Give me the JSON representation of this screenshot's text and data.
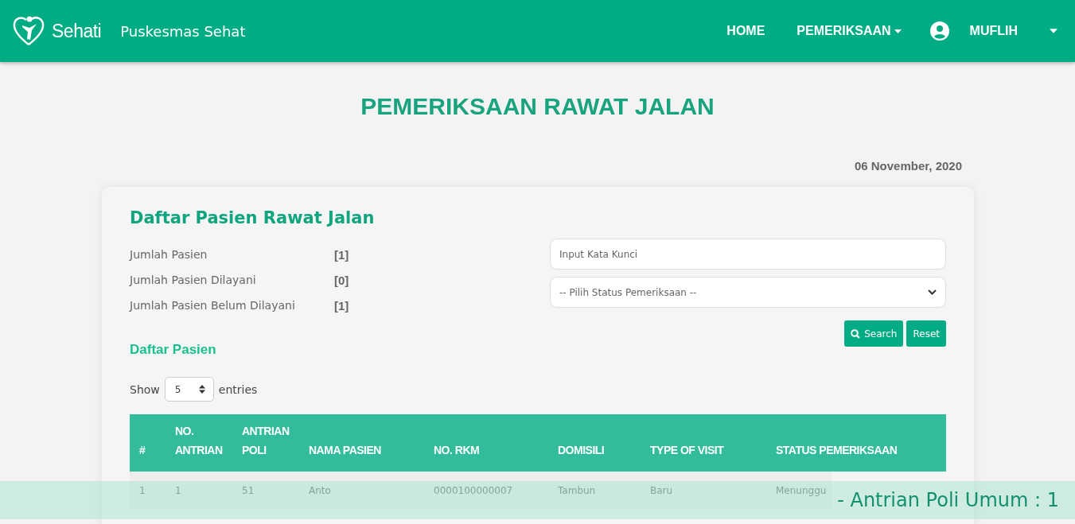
{
  "header": {
    "logo_text": "Sehati",
    "app_name": "Puskesmas Sehat",
    "nav": [
      {
        "label": "HOME",
        "dropdown": false
      },
      {
        "label": "PEMERIKSAAN",
        "dropdown": true
      }
    ],
    "user": {
      "name": "MUFLIH"
    }
  },
  "page": {
    "title": "PEMERIKSAAN RAWAT JALAN",
    "date": "06 November, 2020"
  },
  "card": {
    "title": "Daftar Pasien Rawat Jalan",
    "stats": [
      {
        "label": "Jumlah Pasien",
        "value": "[1]"
      },
      {
        "label": "Jumlah Pasien Dilayani",
        "value": "[0]"
      },
      {
        "label": "Jumlah Pasien Belum Dilayani",
        "value": "[1]"
      }
    ],
    "search": {
      "placeholder": "Input Kata Kunci"
    },
    "status_select": {
      "value": "-- Pilih Status Pemeriksaan --"
    },
    "buttons": [
      {
        "label": "Search",
        "kind": "search"
      },
      {
        "label": "Reset",
        "kind": "reset"
      }
    ],
    "section_title": "Daftar Pasien",
    "show_entries": {
      "prefix": "Show",
      "value": "5",
      "suffix": "entries"
    },
    "table": {
      "columns": [
        "#",
        "NO. ANTRIAN",
        "ANTRIAN POLI",
        "NAMA PASIEN",
        "NO. RKM",
        "DOMISILI",
        "TYPE OF VISIT",
        "STATUS PEMERIKSAAN"
      ],
      "rows": [
        [
          "1",
          "1",
          "51",
          "Anto",
          "0000100000007",
          "Tambun",
          "Baru",
          "Menunggu"
        ]
      ]
    }
  },
  "marquee": {
    "text": "- Antrian Poli Umum : 1"
  }
}
